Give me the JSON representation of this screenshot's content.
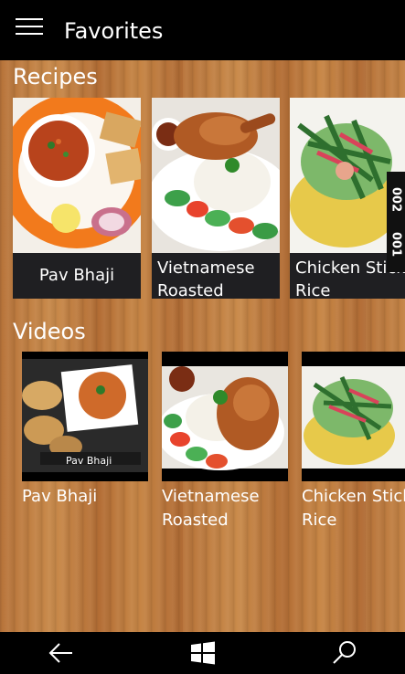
{
  "app": {
    "title": "Favorites"
  },
  "recipes": {
    "heading": "Recipes",
    "items": [
      {
        "line1": "Pav Bhaji",
        "line2": ""
      },
      {
        "line1": "Vietnamese",
        "line2": "Roasted"
      },
      {
        "line1": "Chicken Sticky",
        "line2": "Rice"
      }
    ]
  },
  "videos": {
    "heading": "Videos",
    "items": [
      {
        "line1": "Pav Bhaji",
        "line2": "",
        "thumb_caption": "Pav Bhaji"
      },
      {
        "line1": "Vietnamese",
        "line2": "Roasted"
      },
      {
        "line1": "Chicken Sticky",
        "line2": "Rice"
      }
    ]
  },
  "side_tab": {
    "labels": [
      "002",
      "001"
    ]
  },
  "nav": {
    "icons": [
      "back-arrow-icon",
      "windows-start-icon",
      "search-icon"
    ]
  },
  "colors": {
    "bar": "#000000",
    "label_bg": "#1f1f22",
    "wood": "#c08040"
  }
}
